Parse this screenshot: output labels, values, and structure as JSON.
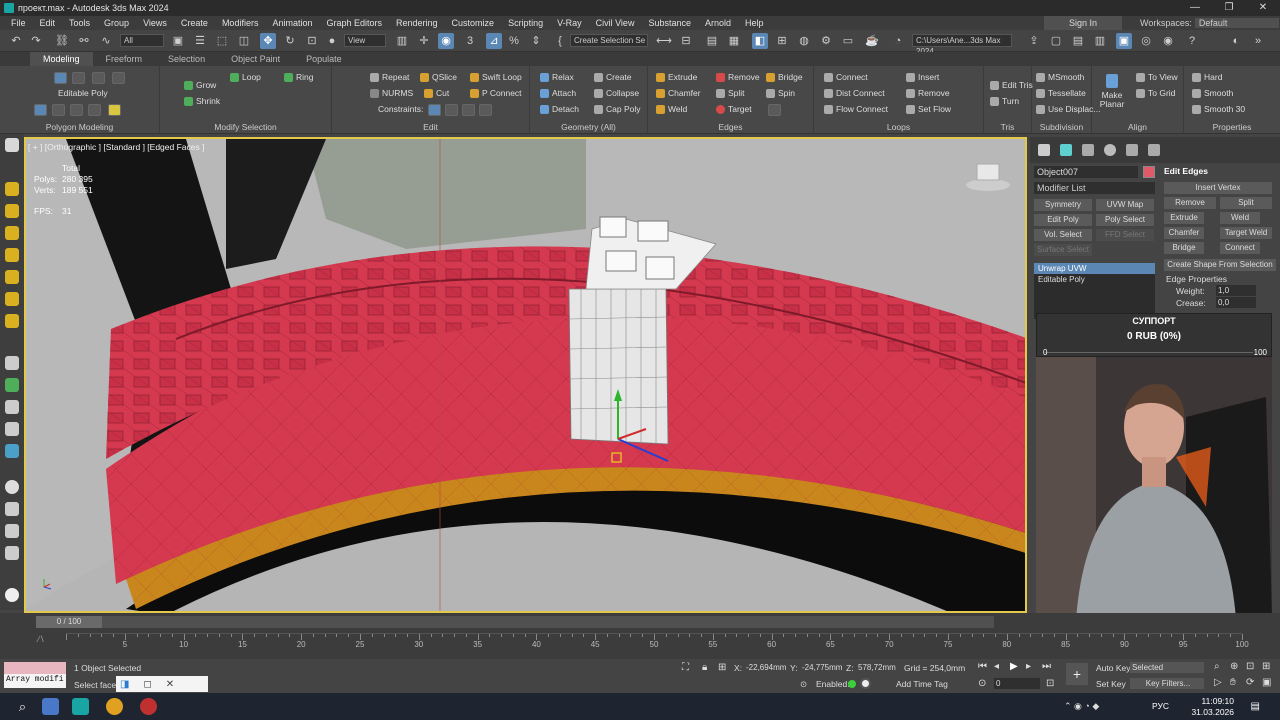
{
  "window": {
    "title": "проект.max - Autodesk 3ds Max 2024",
    "btns": [
      "—",
      "❐",
      "✕"
    ]
  },
  "menu": [
    "File",
    "Edit",
    "Tools",
    "Group",
    "Views",
    "Create",
    "Modifiers",
    "Animation",
    "Graph Editors",
    "Rendering",
    "Customize",
    "Scripting",
    "V-Ray",
    "Civil View",
    "Substance",
    "Arnold",
    "Help"
  ],
  "signin": "Sign In",
  "workspaces": {
    "label": "Workspaces:",
    "value": "Default"
  },
  "toolbar": {
    "filter": "All",
    "view": "View",
    "selection_set": "Create Selection Se",
    "path": "C:\\Users\\Ane...3ds Max 2024"
  },
  "ribbon_tabs": [
    "Modeling",
    "Freeform",
    "Selection",
    "Object Paint",
    "Populate"
  ],
  "ribbon": {
    "polygon_modeling": {
      "title": "Polygon Modeling",
      "editable": "Editable Poly"
    },
    "modify_selection": {
      "title": "Modify Selection",
      "grow": "Grow",
      "shrink": "Shrink",
      "loop": "Loop",
      "ring": "Ring"
    },
    "edit": {
      "title": "Edit",
      "repeat": "Repeat",
      "qslice": "QSlice",
      "swift_loop": "Swift Loop",
      "nurms": "NURMS",
      "cut": "Cut",
      "p_connect": "P Connect",
      "constraints": "Constraints:"
    },
    "geometry": {
      "title": "Geometry (All)",
      "relax": "Relax",
      "create": "Create",
      "attach": "Attach",
      "collapse": "Collapse",
      "detach": "Detach",
      "cap_poly": "Cap Poly"
    },
    "edges": {
      "title": "Edges",
      "extrude": "Extrude",
      "remove": "Remove",
      "bridge": "Bridge",
      "chamfer": "Chamfer",
      "split": "Split",
      "spin": "Spin",
      "weld": "Weld",
      "target": "Target"
    },
    "loops": {
      "title": "Loops",
      "connect": "Connect",
      "dist_connect": "Dist Connect",
      "flow_connect": "Flow Connect",
      "insert": "Insert",
      "remove": "Remove",
      "set_flow": "Set Flow"
    },
    "tris": {
      "title": "Tris",
      "edit_tris": "Edit Tris",
      "turn": "Turn"
    },
    "subdivision": {
      "title": "Subdivision",
      "msmooth": "MSmooth",
      "tessellate": "Tessellate",
      "use_displac": "Use Displac..."
    },
    "align": {
      "title": "Align",
      "make_planar": "Make Planar",
      "to_view": "To View",
      "to_grid": "To Grid"
    },
    "properties": {
      "title": "Properties",
      "hard": "Hard",
      "smooth": "Smooth",
      "smooth30": "Smooth 30"
    }
  },
  "viewport": {
    "label": "[ + ] [Orthographic ] [Standard ] [Edged Faces ]",
    "stats": {
      "total": "Total",
      "polys_label": "Polys:",
      "polys": "280 395",
      "verts_label": "Verts:",
      "verts": "189 551",
      "fps_label": "FPS:",
      "fps": "31"
    }
  },
  "command_panel": {
    "object_name": "Object007",
    "modifier_list": "Modifier List",
    "buttons": [
      "Symmetry",
      "UVW Map",
      "Edit Poly",
      "Poly Select",
      "Vol. Select",
      "FFD Select",
      "Surface Select"
    ],
    "stack": [
      "Unwrap UVW",
      "Editable Poly"
    ],
    "rollout_title": "Edit Edges",
    "insert_vertex": "Insert Vertex",
    "remove": "Remove",
    "split": "Split",
    "extrude": "Extrude",
    "weld": "Weld",
    "chamfer": "Chamfer",
    "target_weld": "Target Weld",
    "bridge": "Bridge",
    "connect": "Connect",
    "create_shape": "Create Shape From Selection",
    "edge_properties": "Edge Properties",
    "weight_label": "Weight:",
    "weight": "1,0",
    "crease_label": "Crease:",
    "crease": "0,0"
  },
  "support": {
    "title": "СУППОРТ",
    "value": "0 RUB (0%)",
    "min": "0",
    "max": "100"
  },
  "timeline": {
    "frame": "0 / 100",
    "ticks": [
      "0",
      "5",
      "10",
      "15",
      "20",
      "25",
      "30",
      "35",
      "40",
      "45",
      "50",
      "55",
      "60",
      "65",
      "70",
      "75",
      "80",
      "85",
      "90",
      "95",
      "100"
    ]
  },
  "status": {
    "objects_selected": "1 Object Selected",
    "prompt": "Select faces",
    "script_listener": "Array modifi",
    "x_label": "X:",
    "x": "-22,694mm",
    "y_label": "Y:",
    "y": "-24,775mm",
    "z_label": "Z:",
    "z": "578,72mm",
    "grid": "Grid = 254,0mm",
    "enabled": "Enabled:",
    "add_time_tag": "Add Time Tag",
    "auto_key": "Auto Key",
    "selected": "Selected",
    "set_key": "Set Key",
    "key_filters": "Key Filters...",
    "frame_field": "0"
  },
  "taskbar": {
    "time": "11:09:10",
    "date": "31.03.2026",
    "lang": "РУС"
  },
  "colors": {
    "accent": "#5b87b5",
    "tire_red": "#d5394f",
    "rim_gold": "#c8861c"
  }
}
